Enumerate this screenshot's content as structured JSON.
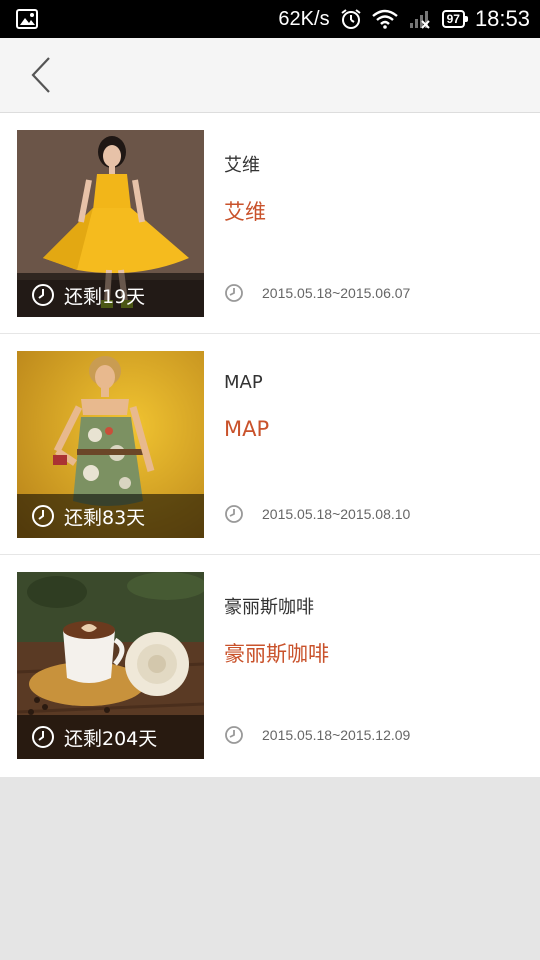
{
  "status_bar": {
    "speed": "62K/s",
    "battery": "97",
    "time": "18:53",
    "icons": [
      "image-icon",
      "alarm-icon",
      "wifi-icon",
      "signal-icon",
      "battery-icon"
    ]
  },
  "header": {
    "back_icon": "back-chevron-icon"
  },
  "items": [
    {
      "thumb_subject": "yellow dress model",
      "remaining": "还剩19天",
      "brand_small": "艾维",
      "brand_big": "艾维",
      "date_range": "2015.05.18~2015.06.07"
    },
    {
      "thumb_subject": "floral dress model",
      "remaining": "还剩83天",
      "brand_small": "MAP",
      "brand_big": "MAP",
      "date_range": "2015.05.18~2015.08.10"
    },
    {
      "thumb_subject": "coffee cup and rose",
      "remaining": "还剩204天",
      "brand_small": "豪丽斯咖啡",
      "brand_big": "豪丽斯咖啡",
      "date_range": "2015.05.18~2015.12.09"
    }
  ],
  "colors": {
    "accent": "#c9522b",
    "header_bg": "#f5f5f5",
    "page_bg": "#e5e5e5"
  }
}
